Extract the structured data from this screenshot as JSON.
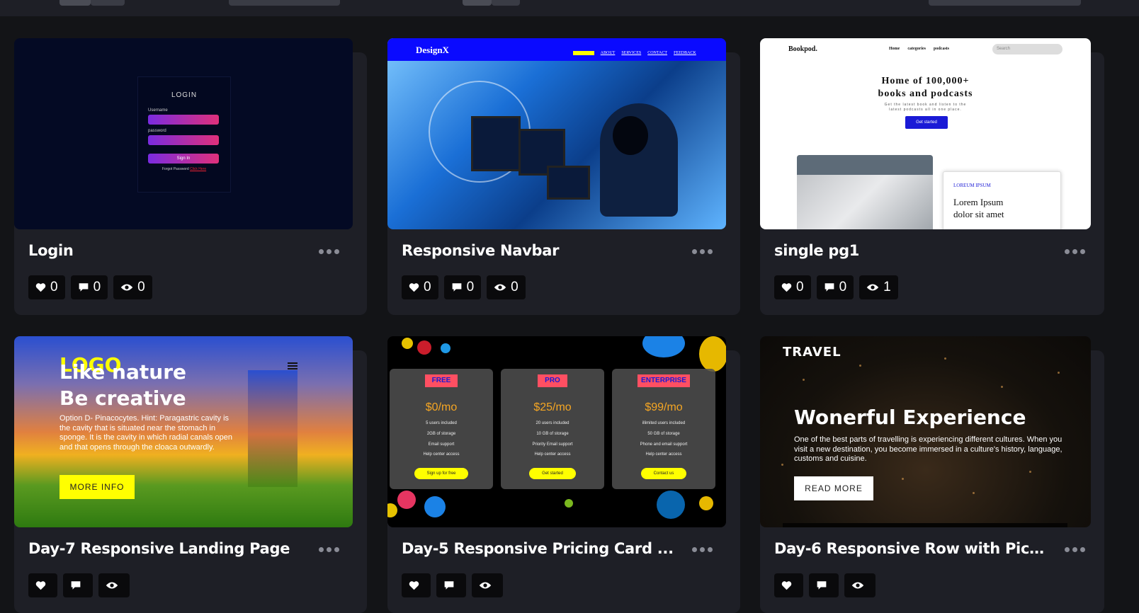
{
  "cards": [
    {
      "title": "Login",
      "likes": "0",
      "comments": "0",
      "views": "0",
      "preview": {
        "heading": "LOGIN",
        "username_label": "Username",
        "password_label": "password",
        "button": "Sign In",
        "forgot": "Forgot Password",
        "click_here": "Click Here"
      }
    },
    {
      "title": "Responsive Navbar",
      "likes": "0",
      "comments": "0",
      "views": "0",
      "preview": {
        "logo": "DesignX",
        "links": [
          "HOME",
          "ABOUT",
          "SERVICES",
          "CONTACT",
          "FEEDBACK"
        ]
      }
    },
    {
      "title": "single pg1",
      "likes": "0",
      "comments": "0",
      "views": "1",
      "preview": {
        "brand": "Bookpod.",
        "links": [
          "Home",
          "categories",
          "podcasts"
        ],
        "search_placeholder": "Search",
        "heading_line1": "Home of 100,000+",
        "heading_line2": "books and podcasts",
        "sub_line1": "Get the latest book and listen to the",
        "sub_line2": "latest podcasts all in one place.",
        "button": "Get started",
        "card_label": "LOREUM IPSUM",
        "card_text_line1": "Lorem Ipsum",
        "card_text_line2": "dolor sit amet"
      }
    },
    {
      "title": "Day-7 Responsive Landing Page",
      "likes": "",
      "comments": "",
      "views": "",
      "preview": {
        "logo": "LOGO",
        "heading_line1": "Like nature",
        "heading_line2": "Be creative",
        "paragraph": "Option D- Pinacocytes. Hint: Paragastric cavity is the cavity that is situated near the stomach in sponge. It is the cavity in which radial canals open and that opens through the cloaca outwardly.",
        "button": "MORE INFO"
      }
    },
    {
      "title": "Day-5 Responsive Pricing Card ...",
      "likes": "",
      "comments": "",
      "views": "",
      "preview": {
        "plans": [
          {
            "tag": "FREE",
            "price": "$0/mo",
            "features": [
              "5 users included",
              "2GB of storage",
              "Email support",
              "Help center access"
            ],
            "cta": "Sign up for free"
          },
          {
            "tag": "PRO",
            "price": "$25/mo",
            "features": [
              "20 users included",
              "10 GB of storage",
              "Priority Email support",
              "Help center access"
            ],
            "cta": "Get started"
          },
          {
            "tag": "ENTERPRISE",
            "price": "$99/mo",
            "features": [
              "illimited users included",
              "50 GB of storage",
              "Phone and email support",
              "Help center access"
            ],
            "cta": "Contact us"
          }
        ]
      }
    },
    {
      "title": "Day-6 Responsive Row with Pict...",
      "likes": "",
      "comments": "",
      "views": "",
      "preview": {
        "brand": "TRAVEL",
        "heading": "Wonerful Experience",
        "paragraph": "One of the best parts of travelling is experiencing different cultures. When you visit a new destination, you become immersed in a culture's history, language, customs and cuisine.",
        "button": "READ MORE"
      }
    }
  ],
  "icons": {
    "like": "heart-icon",
    "comment": "comment-icon",
    "view": "eye-icon",
    "more": "more-dots-icon"
  },
  "colors": {
    "background": "#131417",
    "card": "#1e1f26",
    "stat_bg": "#0a0a0c"
  }
}
